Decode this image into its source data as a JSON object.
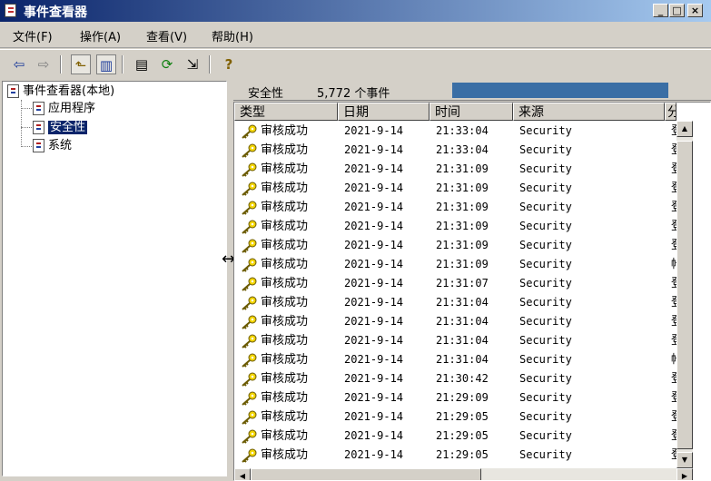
{
  "window": {
    "title": "事件查看器"
  },
  "menu": [
    {
      "label": "文件(F)"
    },
    {
      "label": "操作(A)"
    },
    {
      "label": "查看(V)"
    },
    {
      "label": "帮助(H)"
    }
  ],
  "tree": {
    "root": "事件查看器(本地)",
    "children": [
      {
        "label": "应用程序"
      },
      {
        "label": "安全性"
      },
      {
        "label": "系统"
      }
    ]
  },
  "pane": {
    "title": "安全性",
    "count": "5,772 个事件"
  },
  "columns": [
    "类型",
    "日期",
    "时间",
    "来源",
    "分类"
  ],
  "rows": [
    {
      "type": "审核成功",
      "date": "2021-9-14",
      "time": "21:33:04",
      "source": "Security",
      "category": "登录"
    },
    {
      "type": "审核成功",
      "date": "2021-9-14",
      "time": "21:33:04",
      "source": "Security",
      "category": "登录"
    },
    {
      "type": "审核成功",
      "date": "2021-9-14",
      "time": "21:31:09",
      "source": "Security",
      "category": "登录"
    },
    {
      "type": "审核成功",
      "date": "2021-9-14",
      "time": "21:31:09",
      "source": "Security",
      "category": "登录"
    },
    {
      "type": "审核成功",
      "date": "2021-9-14",
      "time": "21:31:09",
      "source": "Security",
      "category": "登录"
    },
    {
      "type": "审核成功",
      "date": "2021-9-14",
      "time": "21:31:09",
      "source": "Security",
      "category": "登录"
    },
    {
      "type": "审核成功",
      "date": "2021-9-14",
      "time": "21:31:09",
      "source": "Security",
      "category": "登录"
    },
    {
      "type": "审核成功",
      "date": "2021-9-14",
      "time": "21:31:09",
      "source": "Security",
      "category": "帐户"
    },
    {
      "type": "审核成功",
      "date": "2021-9-14",
      "time": "21:31:07",
      "source": "Security",
      "category": "登录"
    },
    {
      "type": "审核成功",
      "date": "2021-9-14",
      "time": "21:31:04",
      "source": "Security",
      "category": "登录"
    },
    {
      "type": "审核成功",
      "date": "2021-9-14",
      "time": "21:31:04",
      "source": "Security",
      "category": "登录"
    },
    {
      "type": "审核成功",
      "date": "2021-9-14",
      "time": "21:31:04",
      "source": "Security",
      "category": "登录"
    },
    {
      "type": "审核成功",
      "date": "2021-9-14",
      "time": "21:31:04",
      "source": "Security",
      "category": "帐户"
    },
    {
      "type": "审核成功",
      "date": "2021-9-14",
      "time": "21:30:42",
      "source": "Security",
      "category": "登录"
    },
    {
      "type": "审核成功",
      "date": "2021-9-14",
      "time": "21:29:09",
      "source": "Security",
      "category": "登录"
    },
    {
      "type": "审核成功",
      "date": "2021-9-14",
      "time": "21:29:05",
      "source": "Security",
      "category": "登录"
    },
    {
      "type": "审核成功",
      "date": "2021-9-14",
      "time": "21:29:05",
      "source": "Security",
      "category": "登录"
    },
    {
      "type": "审核成功",
      "date": "2021-9-14",
      "time": "21:29:05",
      "source": "Security",
      "category": "登录"
    }
  ],
  "icons": {
    "row": "key-icon",
    "toolbar": [
      "back-arrow-icon",
      "forward-arrow-icon",
      "up-folder-icon",
      "show-hide-tree-icon",
      "properties-icon",
      "refresh-icon",
      "export-list-icon",
      "help-icon"
    ]
  }
}
